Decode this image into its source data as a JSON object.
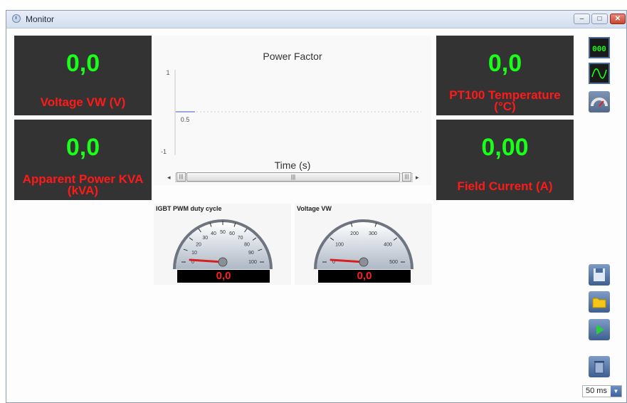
{
  "window": {
    "title": "Monitor",
    "buttons": [
      "minimize",
      "maximize",
      "close"
    ]
  },
  "panels": [
    {
      "value": "0,0",
      "label": "Voltage VW (V)"
    },
    {
      "value": "0,0",
      "label": "Apparent Power KVA (kVA)"
    },
    {
      "value": "0,0",
      "label": "PT100 Temperature (°C)"
    },
    {
      "value": "0,00",
      "label": "Field Current (A)"
    }
  ],
  "chart_data": {
    "type": "line",
    "title": "Power Factor",
    "xlabel": "Time (s)",
    "ylabel": "",
    "ylim": [
      -1,
      1
    ],
    "y_ticks": [
      "1",
      "0.5",
      "-1"
    ],
    "series": [
      {
        "values": []
      }
    ],
    "grid": false
  },
  "gauges": [
    {
      "title": "IGBT PWM duty cycle",
      "value_text": "0,0",
      "value": 0,
      "min": 0,
      "max": 100,
      "ticks": [
        "0",
        "10",
        "20",
        "30",
        "40",
        "50",
        "60",
        "70",
        "80",
        "90",
        "100"
      ]
    },
    {
      "title": "Voltage VW",
      "value_text": "0,0",
      "value": 0,
      "min": 0,
      "max": 500,
      "ticks": [
        "0",
        "100",
        "200",
        "300",
        "400",
        "500"
      ]
    }
  ],
  "toolbar": {
    "icons": [
      "digital-display-icon",
      "oscilloscope-icon",
      "gauge-icon",
      "save-icon",
      "folder-icon",
      "play-icon",
      "trash-icon"
    ],
    "interval": "50 ms",
    "colors": {
      "panel_bg": "#333333",
      "value": "#19ff19",
      "label": "#ff1a1a"
    }
  }
}
